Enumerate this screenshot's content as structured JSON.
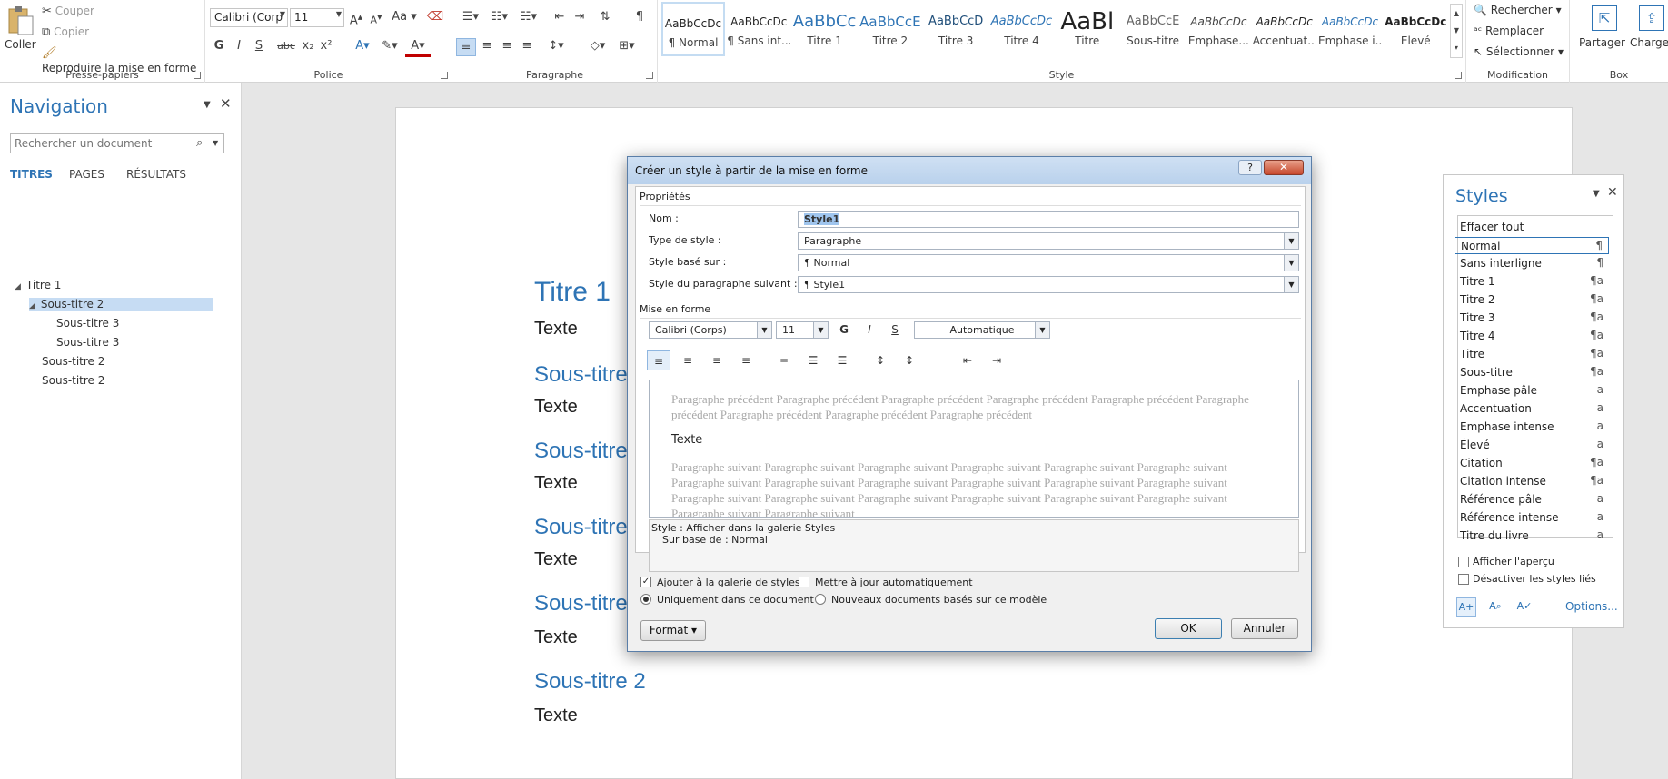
{
  "ribbon": {
    "clipboard": {
      "paste": "Coller",
      "cut": "Couper",
      "copy": "Copier",
      "format_painter": "Reproduire la mise en forme",
      "label": "Presse-papiers"
    },
    "font": {
      "family": "Calibri (Corp",
      "size": "11",
      "case": "Aa",
      "label": "Police",
      "bold": "G",
      "italic": "I",
      "underline": "S",
      "strike": "abc",
      "sub": "x₂",
      "sup": "x²",
      "grow": "A",
      "shrink": "A"
    },
    "paragraph": {
      "label": "Paragraphe"
    },
    "styles": {
      "label": "Style",
      "items": [
        {
          "preview": "AaBbCcDc",
          "name": "¶ Normal"
        },
        {
          "preview": "AaBbCcDc",
          "name": "¶ Sans int..."
        },
        {
          "preview": "AaBbCc",
          "name": "Titre 1"
        },
        {
          "preview": "AaBbCcE",
          "name": "Titre 2"
        },
        {
          "preview": "AaBbCcD",
          "name": "Titre 3"
        },
        {
          "preview": "AaBbCcDc",
          "name": "Titre 4"
        },
        {
          "preview": "AaBl",
          "name": "Titre"
        },
        {
          "preview": "AaBbCcE",
          "name": "Sous-titre"
        },
        {
          "preview": "AaBbCcDc",
          "name": "Emphase..."
        },
        {
          "preview": "AaBbCcDc",
          "name": "Accentuat..."
        },
        {
          "preview": "AaBbCcDc",
          "name": "Emphase i..."
        },
        {
          "preview": "AaBbCcDc",
          "name": "Élevé"
        }
      ]
    },
    "editing": {
      "label": "Modification",
      "find": "Rechercher",
      "replace": "Remplacer",
      "select": "Sélectionner"
    },
    "box": {
      "label": "Box",
      "share": "Partager",
      "upload": "Charger"
    }
  },
  "navigation": {
    "title": "Navigation",
    "search_placeholder": "Rechercher un document",
    "tabs": [
      "TITRES",
      "PAGES",
      "RÉSULTATS"
    ],
    "tree": [
      {
        "label": "Titre 1",
        "level": 0
      },
      {
        "label": "Sous-titre 2",
        "level": 1
      },
      {
        "label": "Sous-titre 3",
        "level": 2
      },
      {
        "label": "Sous-titre 3",
        "level": 2
      },
      {
        "label": "Sous-titre 2",
        "level": 1
      },
      {
        "label": "Sous-titre 2",
        "level": 1
      }
    ]
  },
  "document": {
    "heading1": "Titre 1",
    "text": "Texte",
    "subtitle": "Sous-titre",
    "subtitle_full": "Sous-titre 2"
  },
  "dialog": {
    "title": "Créer un style à partir de la mise en forme",
    "properties_label": "Propriétés",
    "name_label": "Nom :",
    "name_value": "Style1",
    "type_label": "Type de style :",
    "type_value": "Paragraphe",
    "based_label": "Style basé sur :",
    "based_value": "¶  Normal",
    "next_label": "Style du paragraphe suivant :",
    "next_value": "¶  Style1",
    "format_label": "Mise en forme",
    "font_value": "Calibri (Corps)",
    "size_value": "11",
    "bold": "G",
    "italic": "I",
    "underline": "S",
    "color_value": "Automatique",
    "preview_before": "Paragraphe précédent Paragraphe précédent Paragraphe précédent Paragraphe précédent Paragraphe précédent Paragraphe précédent Paragraphe précédent Paragraphe précédent Paragraphe précédent",
    "preview_text": "Texte",
    "preview_after": "Paragraphe suivant Paragraphe suivant Paragraphe suivant Paragraphe suivant Paragraphe suivant Paragraphe suivant Paragraphe suivant Paragraphe suivant Paragraphe suivant Paragraphe suivant Paragraphe suivant Paragraphe suivant Paragraphe suivant Paragraphe suivant Paragraphe suivant Paragraphe suivant Paragraphe suivant Paragraphe suivant Paragraphe suivant Paragraphe suivant",
    "description_line1": "Style : Afficher dans la galerie Styles",
    "description_line2": "Sur base de : Normal",
    "add_gallery": "Ajouter à la galerie de styles",
    "auto_update": "Mettre à jour automatiquement",
    "only_doc": "Uniquement dans ce document",
    "new_docs": "Nouveaux documents basés sur ce modèle",
    "format_btn": "Format",
    "ok": "OK",
    "cancel": "Annuler"
  },
  "styles_pane": {
    "title": "Styles",
    "items": [
      {
        "name": "Effacer tout",
        "glyph": ""
      },
      {
        "name": "Normal",
        "glyph": "¶"
      },
      {
        "name": "Sans interligne",
        "glyph": "¶"
      },
      {
        "name": "Titre 1",
        "glyph": "¶a"
      },
      {
        "name": "Titre 2",
        "glyph": "¶a"
      },
      {
        "name": "Titre 3",
        "glyph": "¶a"
      },
      {
        "name": "Titre 4",
        "glyph": "¶a"
      },
      {
        "name": "Titre",
        "glyph": "¶a"
      },
      {
        "name": "Sous-titre",
        "glyph": "¶a"
      },
      {
        "name": "Emphase pâle",
        "glyph": "a"
      },
      {
        "name": "Accentuation",
        "glyph": "a"
      },
      {
        "name": "Emphase intense",
        "glyph": "a"
      },
      {
        "name": "Élevé",
        "glyph": "a"
      },
      {
        "name": "Citation",
        "glyph": "¶a"
      },
      {
        "name": "Citation intense",
        "glyph": "¶a"
      },
      {
        "name": "Référence pâle",
        "glyph": "a"
      },
      {
        "name": "Référence intense",
        "glyph": "a"
      },
      {
        "name": "Titre du livre",
        "glyph": "a"
      }
    ],
    "show_preview": "Afficher l'aperçu",
    "disable_linked": "Désactiver les styles liés",
    "options": "Options..."
  },
  "colors": {
    "accent": "#2e74b5",
    "selection": "#c6dcf3"
  }
}
